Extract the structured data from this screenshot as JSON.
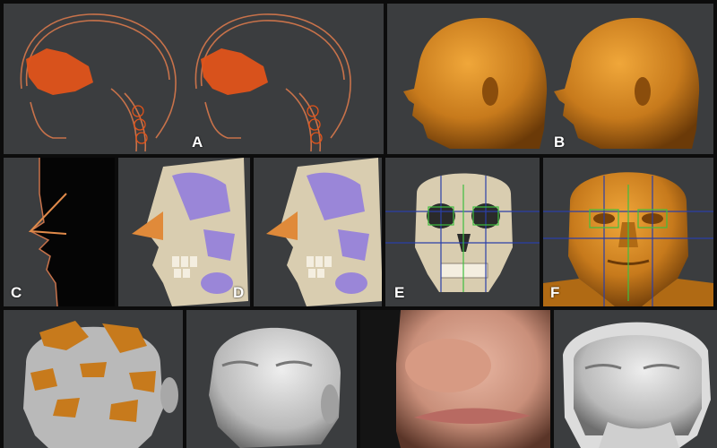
{
  "panels": {
    "a": {
      "label": "A"
    },
    "b": {
      "label": "B"
    },
    "c": {
      "label": "C"
    },
    "d": {
      "label": "D"
    },
    "e": {
      "label": "E"
    },
    "f": {
      "label": "F"
    }
  },
  "colors": {
    "background": "#0c0c0c",
    "panel_gray": "#3b3d3f",
    "skull_line": "#c8724a",
    "sinus_orange": "#e0531a",
    "skin_bronze": "#c77a1c",
    "muscle_purple": "#9a86d8",
    "bone_beige": "#d9cdb0",
    "guide_blue": "#2b3fa8",
    "guide_green": "#3fbf3f",
    "sculpt_gray": "#b9b9b9"
  }
}
